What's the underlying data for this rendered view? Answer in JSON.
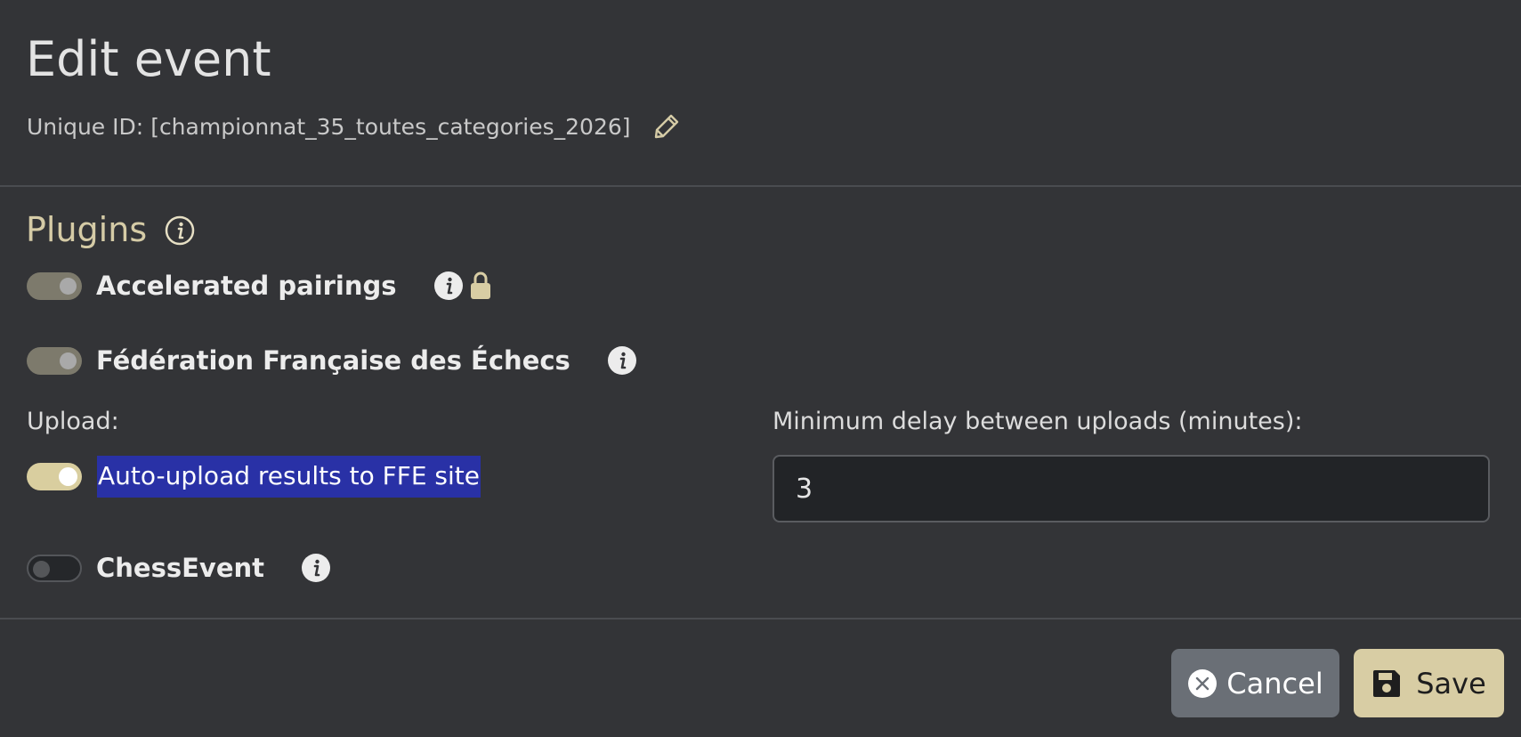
{
  "dialog": {
    "title": "Edit event",
    "unique_id_prefix": "Unique ID:",
    "unique_id_value": "[championnat_35_toutes_categories_2026]"
  },
  "plugins": {
    "section_title": "Plugins",
    "items": [
      {
        "label": "Accelerated pairings",
        "enabled": true,
        "disabled": true,
        "locked": true
      },
      {
        "label": "Fédération Française des Échecs",
        "enabled": true,
        "disabled": true,
        "locked": false
      },
      {
        "label": "ChessEvent",
        "enabled": false,
        "disabled": false,
        "locked": false
      }
    ],
    "ffe": {
      "upload_label": "Upload:",
      "auto_upload_label": "Auto-upload results to FFE site",
      "auto_upload_enabled": true,
      "delay_label": "Minimum delay between uploads (minutes):",
      "delay_value": "3"
    }
  },
  "footer": {
    "cancel_label": "Cancel",
    "save_label": "Save"
  },
  "colors": {
    "background": "#333437",
    "accent": "#d8cda4",
    "selection": "#2931a6",
    "cancel": "#6a6f76"
  },
  "icons": [
    "pencil-icon",
    "info-icon",
    "lock-icon",
    "close-circle-icon",
    "floppy-disk-icon"
  ]
}
